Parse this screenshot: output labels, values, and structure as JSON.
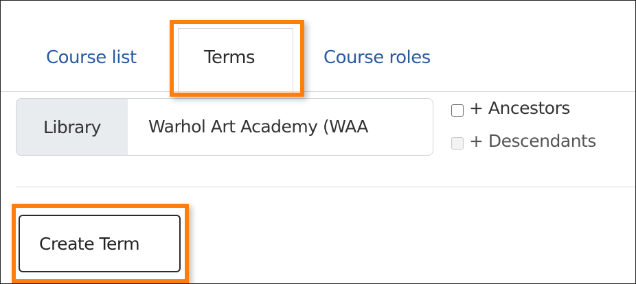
{
  "tabs": [
    {
      "label": "Course list",
      "active": false
    },
    {
      "label": "Terms",
      "active": true
    },
    {
      "label": "Course roles",
      "active": false
    }
  ],
  "library_filter": {
    "prefix_label": "Library",
    "value": "Warhol Art Academy (WAA"
  },
  "options": {
    "ancestors_label": "+ Ancestors",
    "descendants_label": "+ Descendants"
  },
  "actions": {
    "create_term_label": "Create Term"
  },
  "colors": {
    "highlight": "#ff7f0e",
    "link": "#2a5a9f"
  }
}
